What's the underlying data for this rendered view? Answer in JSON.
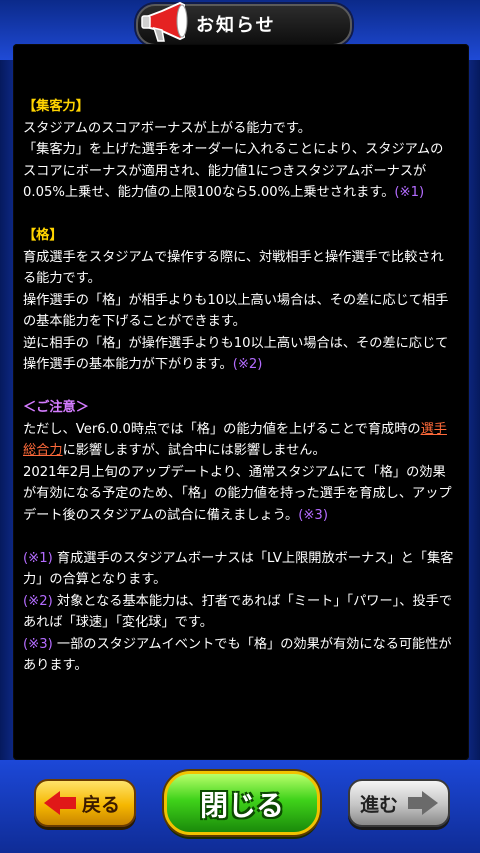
{
  "header": {
    "title": "お知らせ",
    "icon": "megaphone-icon"
  },
  "body": [
    {
      "type": "heading",
      "text": "【集客力】"
    },
    {
      "type": "line",
      "text": "スタジアムのスコアボーナスが上がる能力です。"
    },
    {
      "type": "line",
      "text": "「集客力」を上げた選手をオーダーに入れることにより、スタジアムのスコアにボーナスが適用され、能力値1につきスタジアムボーナスが0.05%上乗せ、能力値の上限100なら5.00%上乗せされます。",
      "ref": "(※1)"
    },
    {
      "type": "gap"
    },
    {
      "type": "heading",
      "text": "【格】"
    },
    {
      "type": "line",
      "text": "育成選手をスタジアムで操作する際に、対戦相手と操作選手で比較される能力です。"
    },
    {
      "type": "line",
      "text": "操作選手の「格」が相手よりも10以上高い場合は、その差に応じて相手の基本能力を下げることができます。"
    },
    {
      "type": "line",
      "text": "逆に相手の「格」が操作選手よりも10以上高い場合は、その差に応じて操作選手の基本能力が下がります。",
      "ref": "(※2)"
    },
    {
      "type": "gap"
    },
    {
      "type": "note-heading",
      "text": "＜ご注意＞"
    },
    {
      "type": "link-line",
      "before": "ただし、Ver6.0.0時点では「格」の能力値を上げることで育成時の",
      "link": "選手総合力",
      "after": "に影響しますが、試合中には影響しません。"
    },
    {
      "type": "line",
      "text": "2021年2月上旬のアップデートより、通常スタジアムにて「格」の効果が有効になる予定のため、「格」の能力値を持った選手を育成し、アップデート後のスタジアムの試合に備えましょう。",
      "ref": "(※3)"
    },
    {
      "type": "gap"
    },
    {
      "type": "footnote",
      "ref": "(※1)",
      "text": " 育成選手のスタジアムボーナスは「LV上限開放ボーナス」と「集客力」の合算となります。"
    },
    {
      "type": "footnote",
      "ref": "(※2)",
      "text": " 対象となる基本能力は、打者であれば「ミート」「パワー」、投手であれば「球速」「変化球」です。"
    },
    {
      "type": "footnote",
      "ref": "(※3)",
      "text": " 一部のスタジアムイベントでも「格」の効果が有効になる可能性があります。"
    }
  ],
  "buttons": {
    "back_label": "戻る",
    "close_label": "閉じる",
    "next_label": "進む"
  },
  "colors": {
    "heading": "#ffd400",
    "note_heading": "#d47cff",
    "ref": "#b46cff",
    "link": "#ff6a3a"
  }
}
